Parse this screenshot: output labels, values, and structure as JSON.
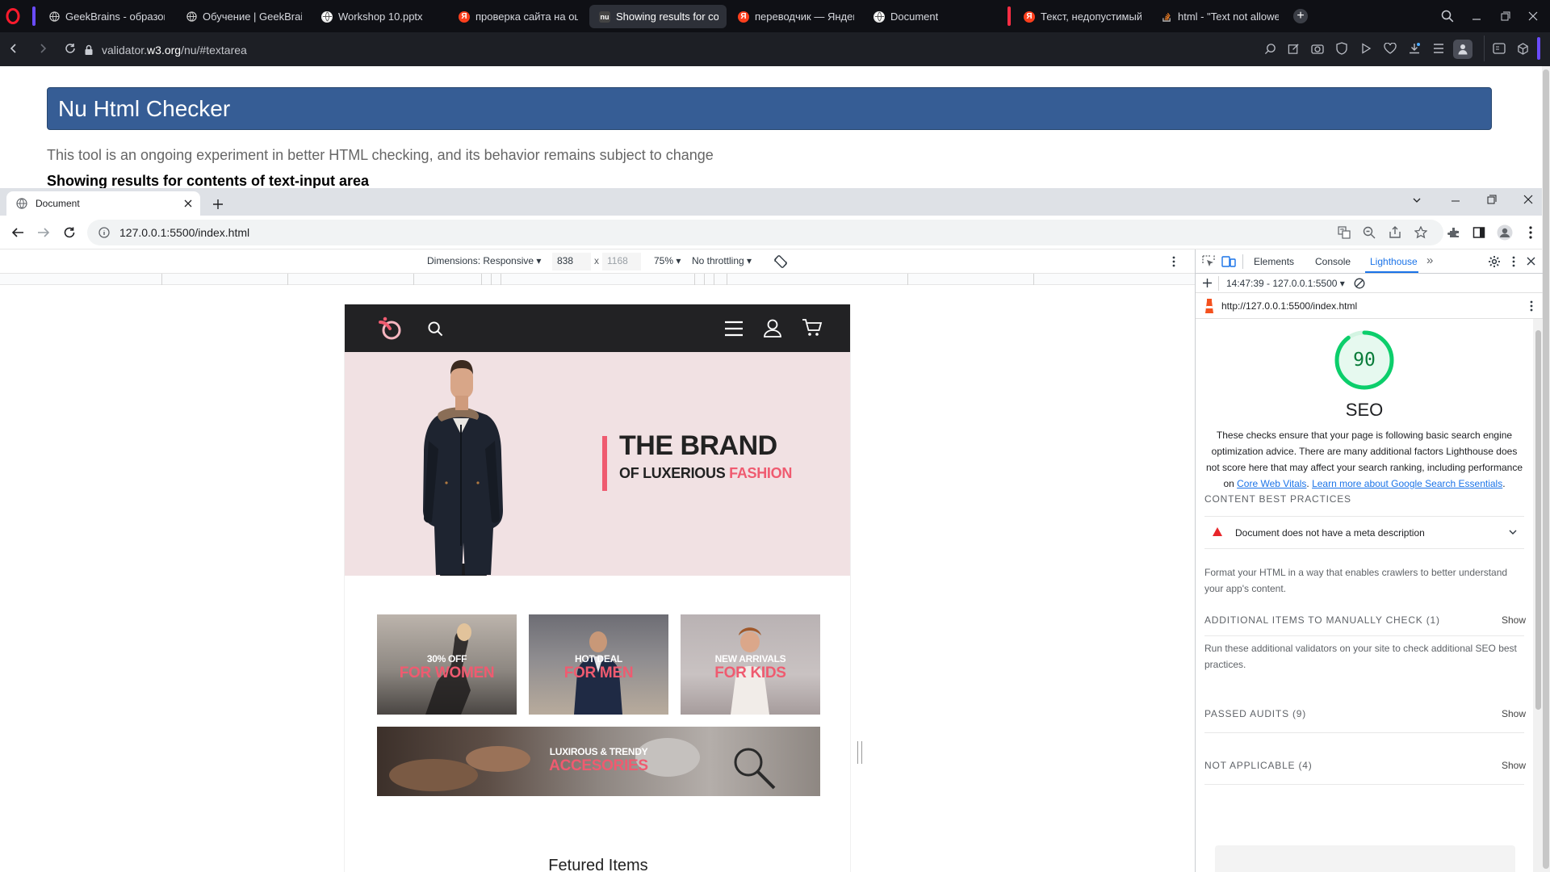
{
  "opera": {
    "tabs": [
      {
        "label": "GeekBrains - образовател",
        "icon": "globe-icon"
      },
      {
        "label": "Обучение | GeekBrains - с",
        "icon": "globe-icon"
      },
      {
        "label": "Workshop 10.pptx",
        "icon": "globe-icon"
      },
      {
        "label": "проверка сайта на ошиб",
        "icon": "yandex-icon"
      },
      {
        "label": "Showing results for conte",
        "icon": "nu-icon",
        "active": true
      },
      {
        "label": "переводчик — Яндекс: н",
        "icon": "yandex-icon"
      },
      {
        "label": "Document",
        "icon": "globe-icon"
      },
      {
        "label": "Текст, недопустимый в э",
        "icon": "yandex-icon"
      },
      {
        "label": "html - \"Text not allowed in",
        "icon": "stackoverflow-icon"
      }
    ],
    "address": {
      "host": "validator.",
      "domain": "w3.org",
      "path": "/nu/#textarea"
    },
    "accent_color": "#6a4cff"
  },
  "validator": {
    "title": "Nu Html Checker",
    "description": "This tool is an ongoing experiment in better HTML checking, and its behavior remains subject to change",
    "showing": "Showing results for contents of text-input area"
  },
  "chrome": {
    "tab_title": "Document",
    "url": "127.0.0.1:5500/index.html"
  },
  "device_toolbar": {
    "dimensions": "Dimensions: Responsive",
    "width": "838",
    "times": "x",
    "height": "1168",
    "zoom": "75%",
    "throttling": "No throttling"
  },
  "emulated_page": {
    "hero_title": "THE BRAND",
    "hero_sub_prefix": "OF LUXERIOUS",
    "hero_sub_accent": "FASHION",
    "categories": [
      {
        "line1": "30% OFF",
        "line2": "FOR WOMEN"
      },
      {
        "line1": "HOT DEAL",
        "line2": "FOR MEN"
      },
      {
        "line1": "NEW ARRIVALS",
        "line2": "FOR KIDS"
      },
      {
        "line1": "LUXIROUS & TRENDY",
        "line2": "ACCESORIES"
      }
    ],
    "featured": "Fetured Items",
    "accent_color": "#ef5b70"
  },
  "devtools": {
    "tabs": [
      "Elements",
      "Console",
      "Lighthouse"
    ],
    "active_tab": "Lighthouse",
    "report_time": "14:47:39 - 127.0.0.1:5500",
    "report_url": "http://127.0.0.1:5500/index.html",
    "score": "90",
    "score_fraction": 0.9,
    "category": "SEO",
    "description_text": "These checks ensure that your page is following basic search engine optimization advice. There are many additional factors Lighthouse does not score here that may affect your search ranking, including performance on",
    "link_vitals": "Core Web Vitals",
    "link_learn": "Learn more about Google Search Essentials",
    "sections": {
      "content_best_practices": "CONTENT BEST PRACTICES",
      "audit_failed": "Document does not have a meta description",
      "content_desc": "Format your HTML in a way that enables crawlers to better understand your app's content.",
      "manual": "ADDITIONAL ITEMS TO MANUALLY CHECK",
      "manual_count": "(1)",
      "manual_desc": "Run these additional validators on your site to check additional SEO best practices.",
      "passed": "PASSED AUDITS",
      "passed_count": "(9)",
      "na": "NOT APPLICABLE",
      "na_count": "(4)",
      "show": "Show"
    },
    "score_color": "#0cce6b"
  }
}
